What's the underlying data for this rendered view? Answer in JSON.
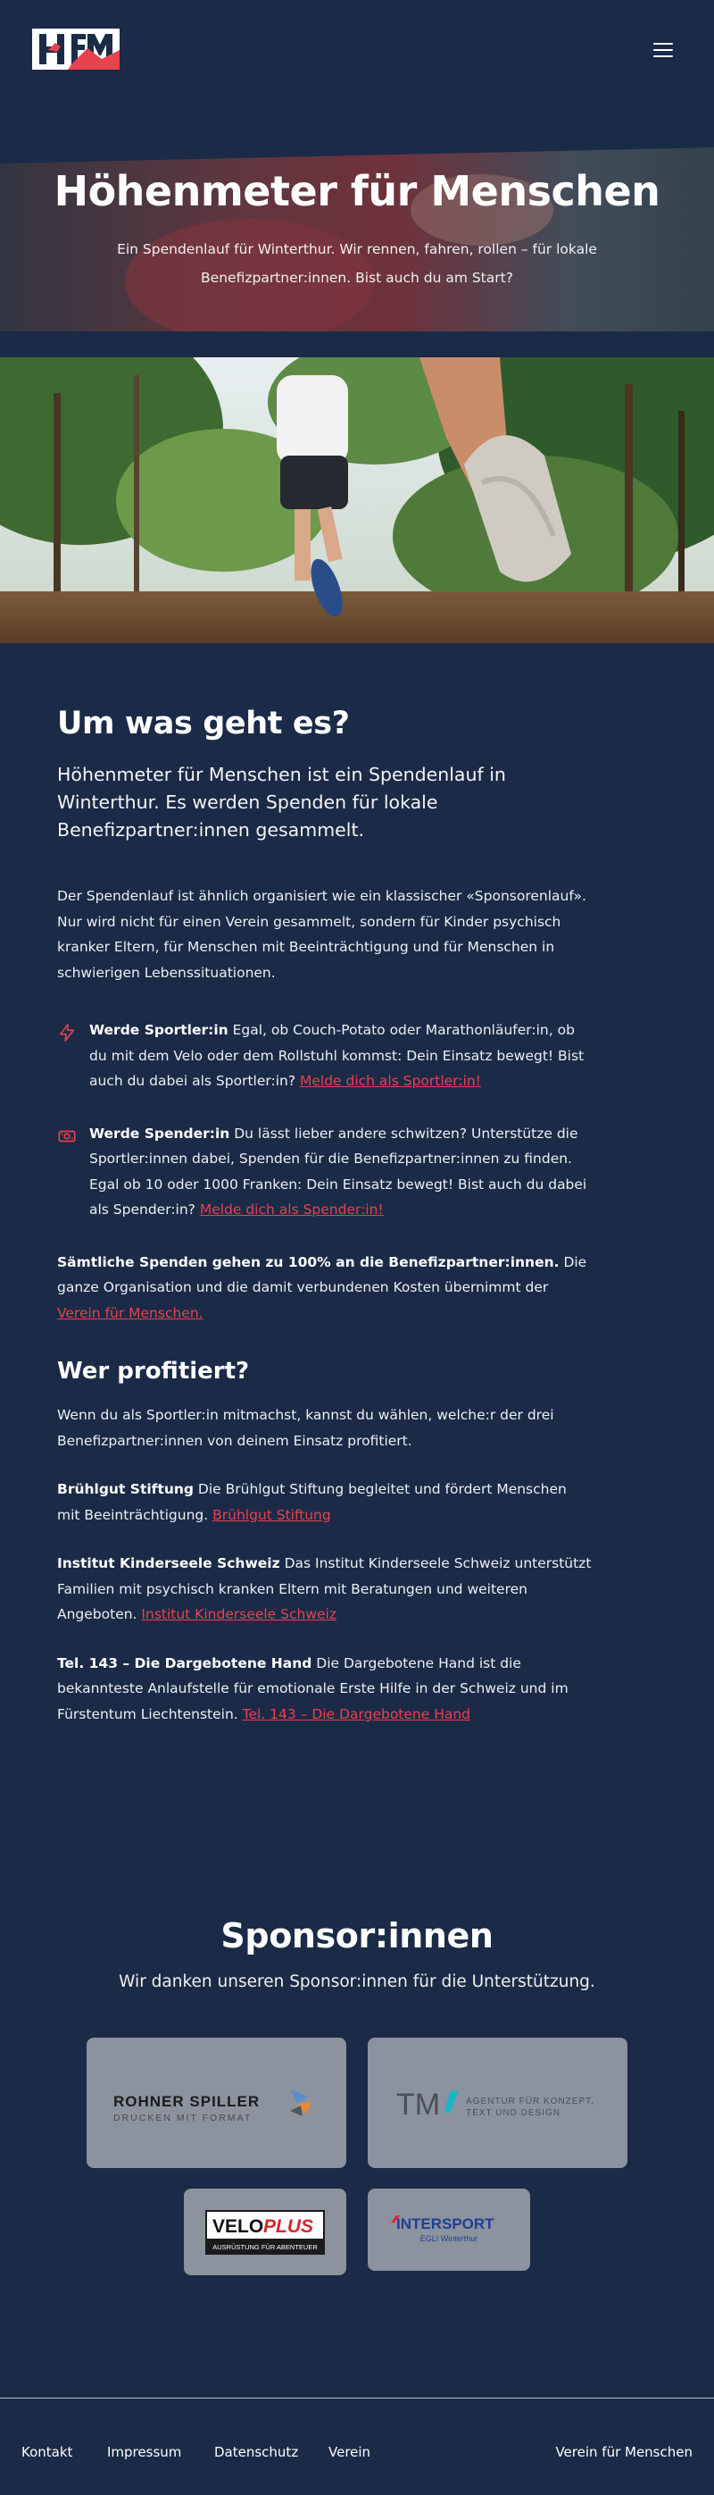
{
  "header": {
    "logo_alt": "HfM",
    "menu_icon": "hamburger-icon"
  },
  "hero": {
    "title": "Höhenmeter für Menschen",
    "subtitle": "Ein Spendenlauf für Winterthur. Wir rennen, fahren, rollen – für lokale Benefizpartner:innen. Bist auch du am Start?"
  },
  "about": {
    "heading": "Um was geht es?",
    "lead": "Höhenmeter für Menschen ist ein Spendenlauf in Winterthur. Es werden Spenden für lokale Benefizpartner:innen gesammelt.",
    "intro": "Der Spendenlauf ist ähnlich organisiert wie ein klassischer «Sponsorenlauf». Nur wird nicht für einen Verein gesammelt, sondern für Kinder psychisch kranker Eltern, für Menschen mit Beeinträchtigung und für Menschen in schwierigen Lebenssituationen.",
    "feature1": {
      "icon": "lightning-icon",
      "title": "Werde Sportler:in",
      "text": " Egal, ob Couch-Potato oder Marathonläufer:in, ob du mit dem Velo oder dem Rollstuhl kommst: Dein Einsatz bewegt! Bist auch du dabei als Sportler:in? ",
      "link": "Melde dich als Sportler:in!"
    },
    "feature2": {
      "icon": "money-icon",
      "title": "Werde Spender:in",
      "text": " Du lässt lieber andere schwitzen? Unterstütze die Sportler:innen dabei, Spenden für die Benefizpartner:innen zu finden. Egal ob 10 oder 1000 Franken: Dein Einsatz bewegt! Bist auch du dabei als Spender:in? ",
      "link": "Melde dich als Spender:in!"
    },
    "donation_bold": "Sämtliche Spenden gehen zu 100% an die Benefizpartner:innen.",
    "donation_text": " Die ganze Organisation und die damit verbundenen Kosten übernimmt der ",
    "donation_link": "Verein für Menschen."
  },
  "beneficiaries": {
    "heading": "Wer profitiert?",
    "intro": "Wenn du als Sportler:in mitmachst, kannst du wählen, welche:r der drei Benefizpartner:innen von deinem Einsatz profitiert.",
    "items": [
      {
        "name": "Brühlgut Stiftung",
        "text": " Die Brühlgut Stiftung begleitet und fördert Menschen mit Beeinträchtigung. ",
        "link": "Brühlgut Stiftung"
      },
      {
        "name": "Institut Kinderseele Schweiz",
        "text": " Das Institut Kinderseele Schweiz unterstützt Familien mit psychisch kranken Eltern mit Beratungen und weiteren Angeboten. ",
        "link": "Institut Kinderseele Schweiz"
      },
      {
        "name": "Tel. 143 – Die Dargebotene Hand",
        "text": " Die Dargebotene Hand ist die bekannteste Anlaufstelle für emotionale Erste Hilfe in der Schweiz und im Fürstentum Liechtenstein. ",
        "link": "Tel. 143 – Die Dargebotene Hand"
      }
    ]
  },
  "sponsors": {
    "heading": "Sponsor:innen",
    "subtitle": "Wir danken unseren Sponsor:innen für die Unterstützung.",
    "logos": [
      {
        "name": "ROHNER SPILLER",
        "tagline": "DRUCKEN MIT FORMAT"
      },
      {
        "name": "TM",
        "tagline1": "AGENTUR FÜR KONZEPT,",
        "tagline2": "TEXT UND DESIGN"
      },
      {
        "name1": "VELO",
        "name2": "PLUS",
        "tagline": "AUSRÜSTUNG FÜR ABENTEUER"
      },
      {
        "name1": "INTERSPORT",
        "tagline": "EGLI Winterthur"
      }
    ]
  },
  "footer": {
    "links": [
      "Kontakt",
      "Impressum",
      "Datenschutz",
      "Verein"
    ],
    "right": "Verein für Menschen"
  },
  "colors": {
    "background": "#1b2a47",
    "accent": "#e8424e"
  }
}
